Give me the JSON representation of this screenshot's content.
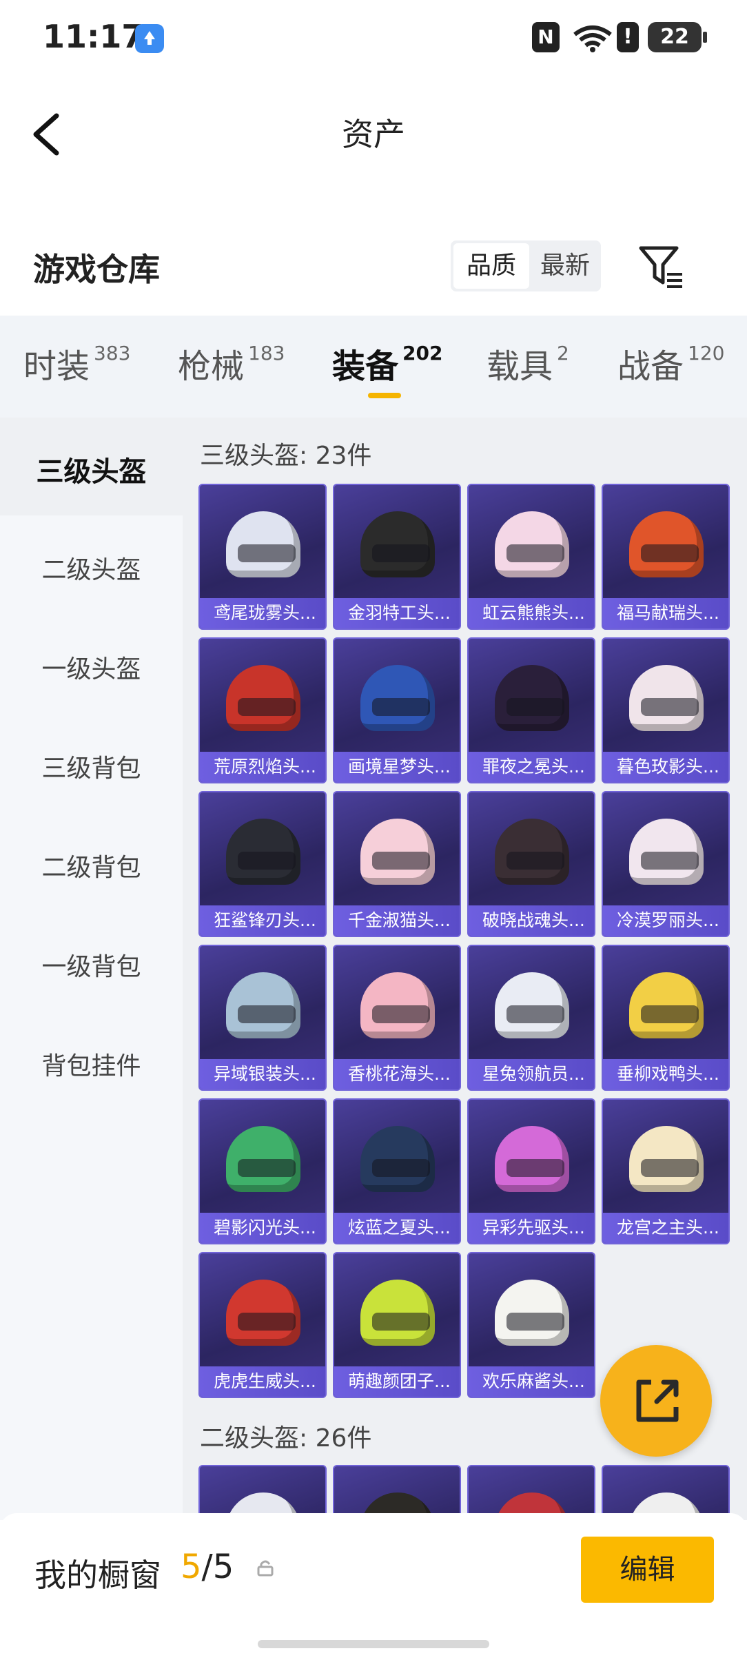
{
  "status_bar": {
    "time": "11:17",
    "icons": [
      "upload-app-icon",
      "nfc-icon",
      "wifi-icon",
      "alert-icon",
      "battery-icon"
    ],
    "nfc_label": "N",
    "alert_label": "!",
    "battery_level": "22"
  },
  "header": {
    "title": "资产"
  },
  "warehouse": {
    "title": "游戏仓库",
    "sort_options": [
      "品质",
      "最新"
    ],
    "selected_sort": "品质"
  },
  "tabs": [
    {
      "label": "时装",
      "count": "383"
    },
    {
      "label": "枪械",
      "count": "183"
    },
    {
      "label": "装备",
      "count": "202",
      "active": true
    },
    {
      "label": "载具",
      "count": "2"
    },
    {
      "label": "战备",
      "count": "120"
    }
  ],
  "sidebar": {
    "items": [
      "三级头盔",
      "二级头盔",
      "一级头盔",
      "三级背包",
      "二级背包",
      "一级背包",
      "背包挂件"
    ],
    "active_index": 0
  },
  "sections": [
    {
      "title": "三级头盔: 23件",
      "items": [
        {
          "name": "鸢尾珑雾头...",
          "color": "#dfe3f0"
        },
        {
          "name": "金羽特工头...",
          "color": "#2b2b2b"
        },
        {
          "name": "虹云熊熊头...",
          "color": "#f4d7e6"
        },
        {
          "name": "福马献瑞头...",
          "color": "#e0552a"
        },
        {
          "name": "荒原烈焰头...",
          "color": "#c8342a"
        },
        {
          "name": "画境星梦头...",
          "color": "#2f57b6"
        },
        {
          "name": "罪夜之冕头...",
          "color": "#2a1f3a"
        },
        {
          "name": "暮色玫影头...",
          "color": "#f0e4ea"
        },
        {
          "name": "狂鲨锋刃头...",
          "color": "#2a2c34"
        },
        {
          "name": "千金淑猫头...",
          "color": "#f6cfd9"
        },
        {
          "name": "破晓战魂头...",
          "color": "#3a2e34"
        },
        {
          "name": "冷漠罗丽头...",
          "color": "#f1e6ee"
        },
        {
          "name": "异域银装头...",
          "color": "#a9c2d6"
        },
        {
          "name": "香桃花海头...",
          "color": "#f4b6c4"
        },
        {
          "name": "星兔领航员...",
          "color": "#e9ecf4"
        },
        {
          "name": "垂柳戏鸭头...",
          "color": "#f2cf45"
        },
        {
          "name": "碧影闪光头...",
          "color": "#3fb06a"
        },
        {
          "name": "炫蓝之夏头...",
          "color": "#263a5e"
        },
        {
          "name": "异彩先驱头...",
          "color": "#d46ad8"
        },
        {
          "name": "龙宫之主头...",
          "color": "#f4e7c4"
        },
        {
          "name": "虎虎生威头...",
          "color": "#d1382f"
        },
        {
          "name": "萌趣颜团子...",
          "color": "#c9e23a"
        },
        {
          "name": "欢乐麻酱头...",
          "color": "#f4f4f0"
        }
      ]
    },
    {
      "title": "二级头盔: 26件",
      "items": [
        {
          "name": "",
          "color": "#e6e8f0"
        },
        {
          "name": "",
          "color": "#2c2a26"
        },
        {
          "name": "",
          "color": "#c0343a"
        },
        {
          "name": "",
          "color": "#efefef"
        }
      ]
    }
  ],
  "showcase": {
    "label": "我的橱窗",
    "current": "5",
    "total": "/5",
    "edit_label": "编辑"
  }
}
